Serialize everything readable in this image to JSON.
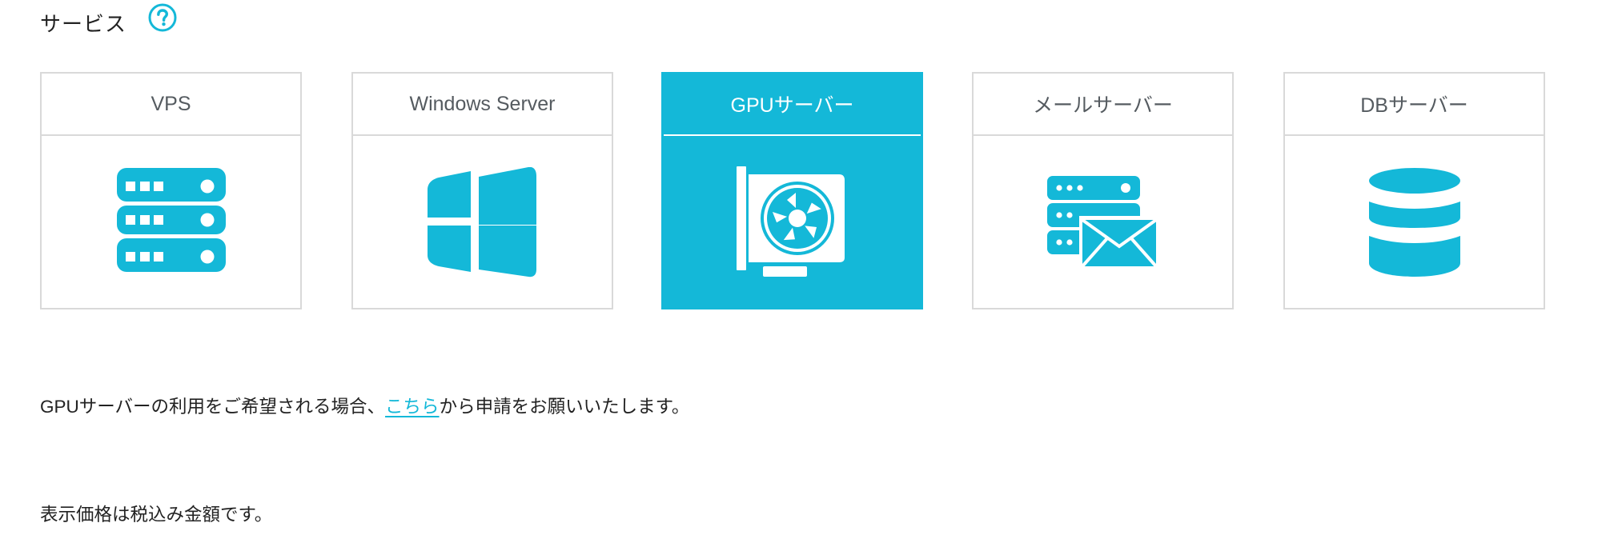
{
  "section": {
    "title": "サービス",
    "help_icon": "question-circle-icon"
  },
  "colors": {
    "accent": "#14b8d8",
    "border": "#d9d9d9",
    "card_title": "#555b60",
    "text": "#222222"
  },
  "services": [
    {
      "label": "VPS",
      "icon": "server-rack-icon",
      "selected": false
    },
    {
      "label": "Windows Server",
      "icon": "windows-logo-icon",
      "selected": false
    },
    {
      "label": "GPUサーバー",
      "icon": "gpu-card-icon",
      "selected": true
    },
    {
      "label": "メールサーバー",
      "icon": "mail-server-icon",
      "selected": false
    },
    {
      "label": "DBサーバー",
      "icon": "database-icon",
      "selected": false
    }
  ],
  "notice": {
    "before_link": "GPUサーバーの利用をご希望される場合、",
    "link_text": "こちら",
    "after_link": "から申請をお願いいたします。"
  },
  "tax_note": "表示価格は税込み金額です。"
}
